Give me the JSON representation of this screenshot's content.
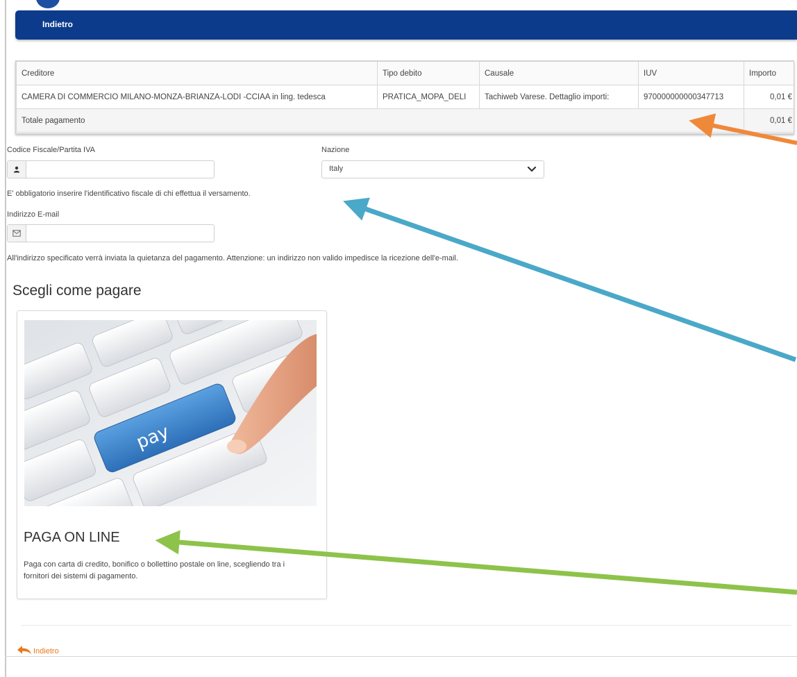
{
  "header": {
    "back_label": "Indietro"
  },
  "table": {
    "columns": [
      "Creditore",
      "Tipo debito",
      "Causale",
      "IUV",
      "Importo"
    ],
    "row": {
      "creditore": "CAMERA DI COMMERCIO MILANO-MONZA-BRIANZA-LODI -CCIAA in ling. tedesca",
      "tipo_debito": "PRATICA_MOPA_DELI",
      "causale": "Tachiweb Varese. Dettaglio importi:",
      "iuv": "970000000000347713",
      "importo": "0,01 €"
    },
    "total_label": "Totale pagamento",
    "total_value": "0,01 €"
  },
  "form": {
    "cf_label": "Codice Fiscale/Partita IVA",
    "cf_value": "",
    "nazione_label": "Nazione",
    "nazione_value": "Italy",
    "cf_note": "E' obbligatorio inserire l'identificativo fiscale di chi effettua il versamento.",
    "email_label": "Indirizzo E-mail",
    "email_value": "",
    "email_note": "All'indirizzo specificato verrà inviata la quietanza del pagamento. Attenzione: un indirizzo non valido impedisce la ricezione dell'e-mail."
  },
  "section": {
    "title": "Scegli come pagare",
    "card": {
      "image_key_label": "pay",
      "title": "PAGA ON LINE",
      "description": "Paga con carta di credito, bonifico o bollettino postale on line, scegliendo tra i fornitori dei sistemi di pagamento."
    }
  },
  "footer": {
    "back_label": "Indietro"
  },
  "colors": {
    "header_blue": "#0d3b8c",
    "link_orange": "#e8791f",
    "arrow_orange": "#f0883a",
    "arrow_teal": "#4aa8c8",
    "arrow_green": "#8dc34a"
  },
  "icons": [
    "user-icon",
    "envelope-icon",
    "chevron-down-icon",
    "back-arrow-icon"
  ]
}
